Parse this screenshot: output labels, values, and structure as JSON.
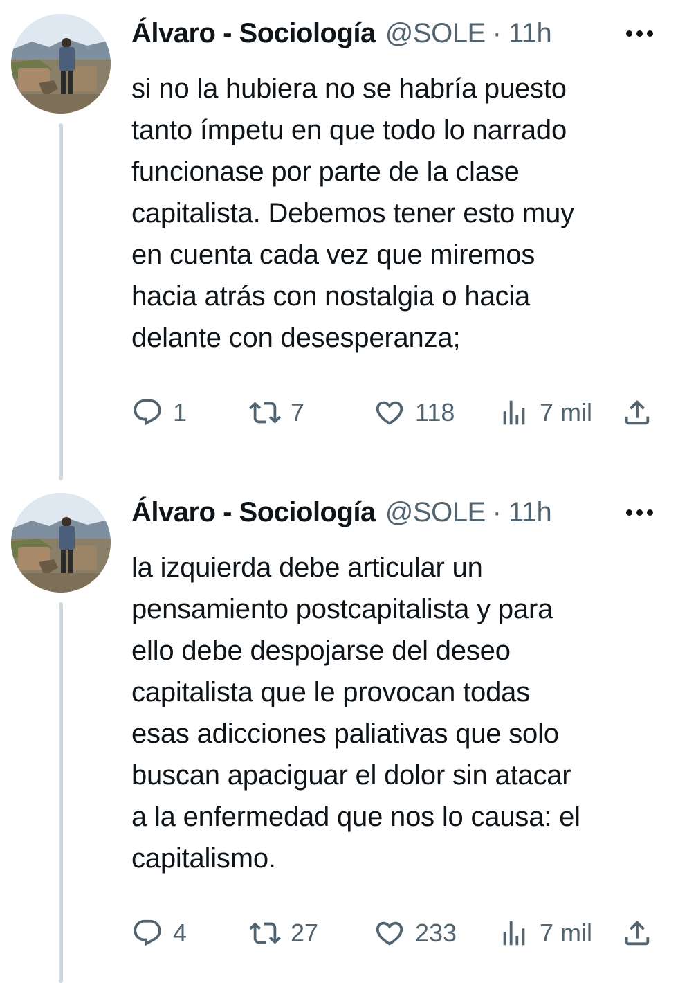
{
  "tweets": [
    {
      "author_name": "Álvaro - Sociología",
      "handle": "@SOLE",
      "separator": "·",
      "time": "11h",
      "text_lines": [
        "si no la hubiera no se habría puesto",
        "tanto ímpetu en que todo lo narrado",
        "funcionase por parte de la clase",
        "capitalista. Debemos tener esto muy",
        "en cuenta cada vez que miremos",
        "hacia atrás con nostalgia o hacia",
        "delante con desesperanza;"
      ],
      "replies": "1",
      "retweets": "7",
      "likes": "118",
      "views": "7 mil"
    },
    {
      "author_name": "Álvaro - Sociología",
      "handle": "@SOLE",
      "separator": "·",
      "time": "11h",
      "text_lines": [
        "la izquierda debe articular un",
        "pensamiento postcapitalista y para",
        "ello debe despojarse del deseo",
        "capitalista que le provocan todas",
        "esas adicciones paliativas que solo",
        "buscan apaciguar el dolor sin atacar",
        "a la enfermedad que nos lo causa: el",
        "capitalismo."
      ],
      "replies": "4",
      "retweets": "27",
      "likes": "233",
      "views": "7 mil"
    }
  ],
  "icons": {
    "more": "more-dots-icon",
    "reply": "reply-icon",
    "retweet": "retweet-icon",
    "like": "heart-icon",
    "views": "views-bar-chart-icon",
    "share": "share-icon"
  },
  "colors": {
    "text_primary": "#0f1419",
    "text_secondary": "#536471",
    "thread_line": "#cfd9de",
    "background": "#ffffff"
  }
}
